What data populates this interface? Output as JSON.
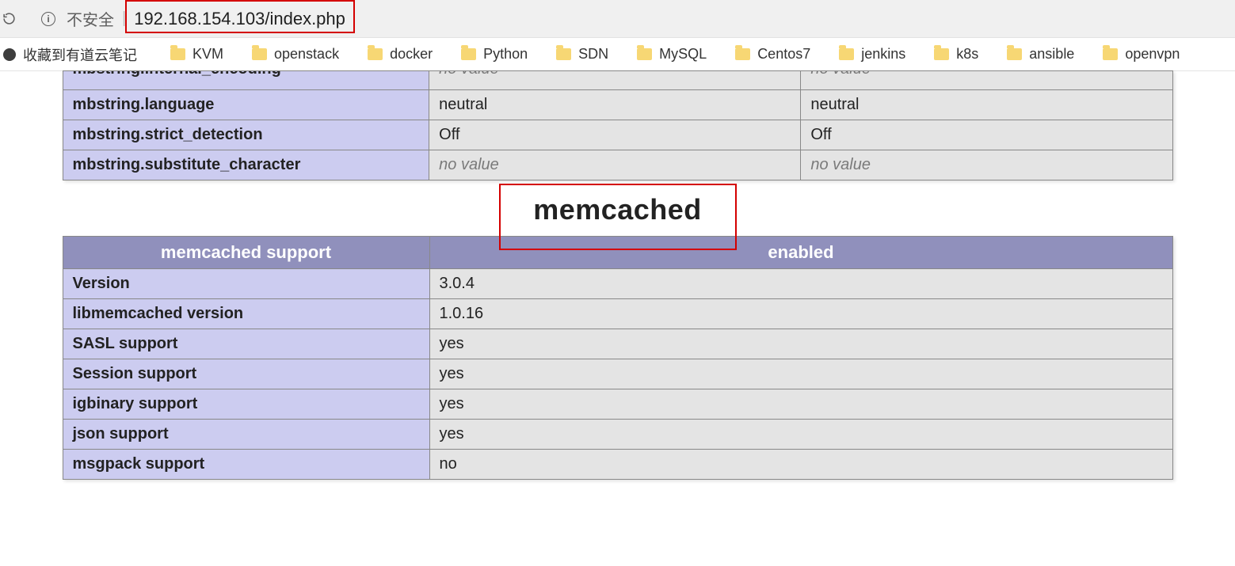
{
  "address_bar": {
    "security_text": "不安全",
    "url": "192.168.154.103/index.php"
  },
  "bookmarks_bar": {
    "first_label": "收藏到有道云笔记",
    "items": [
      "KVM",
      "openstack",
      "docker",
      "Python",
      "SDN",
      "MySQL",
      "Centos7",
      "jenkins",
      "k8s",
      "ansible",
      "openvpn"
    ]
  },
  "mbstring_tail": {
    "cut_label": "mbstring.internal_encoding",
    "cut_local": "no value",
    "cut_master": "no value",
    "rows": [
      {
        "k": "mbstring.language",
        "local": "neutral",
        "master": "neutral",
        "ni": false
      },
      {
        "k": "mbstring.strict_detection",
        "local": "Off",
        "master": "Off",
        "ni": false
      },
      {
        "k": "mbstring.substitute_character",
        "local": "no value",
        "master": "no value",
        "ni": true
      }
    ]
  },
  "section_title": "memcached",
  "memcached": {
    "header_left": "memcached support",
    "header_right": "enabled",
    "rows": [
      {
        "k": "Version",
        "v": "3.0.4"
      },
      {
        "k": "libmemcached version",
        "v": "1.0.16"
      },
      {
        "k": "SASL support",
        "v": "yes"
      },
      {
        "k": "Session support",
        "v": "yes"
      },
      {
        "k": "igbinary support",
        "v": "yes"
      },
      {
        "k": "json support",
        "v": "yes"
      },
      {
        "k": "msgpack support",
        "v": "no"
      }
    ]
  }
}
